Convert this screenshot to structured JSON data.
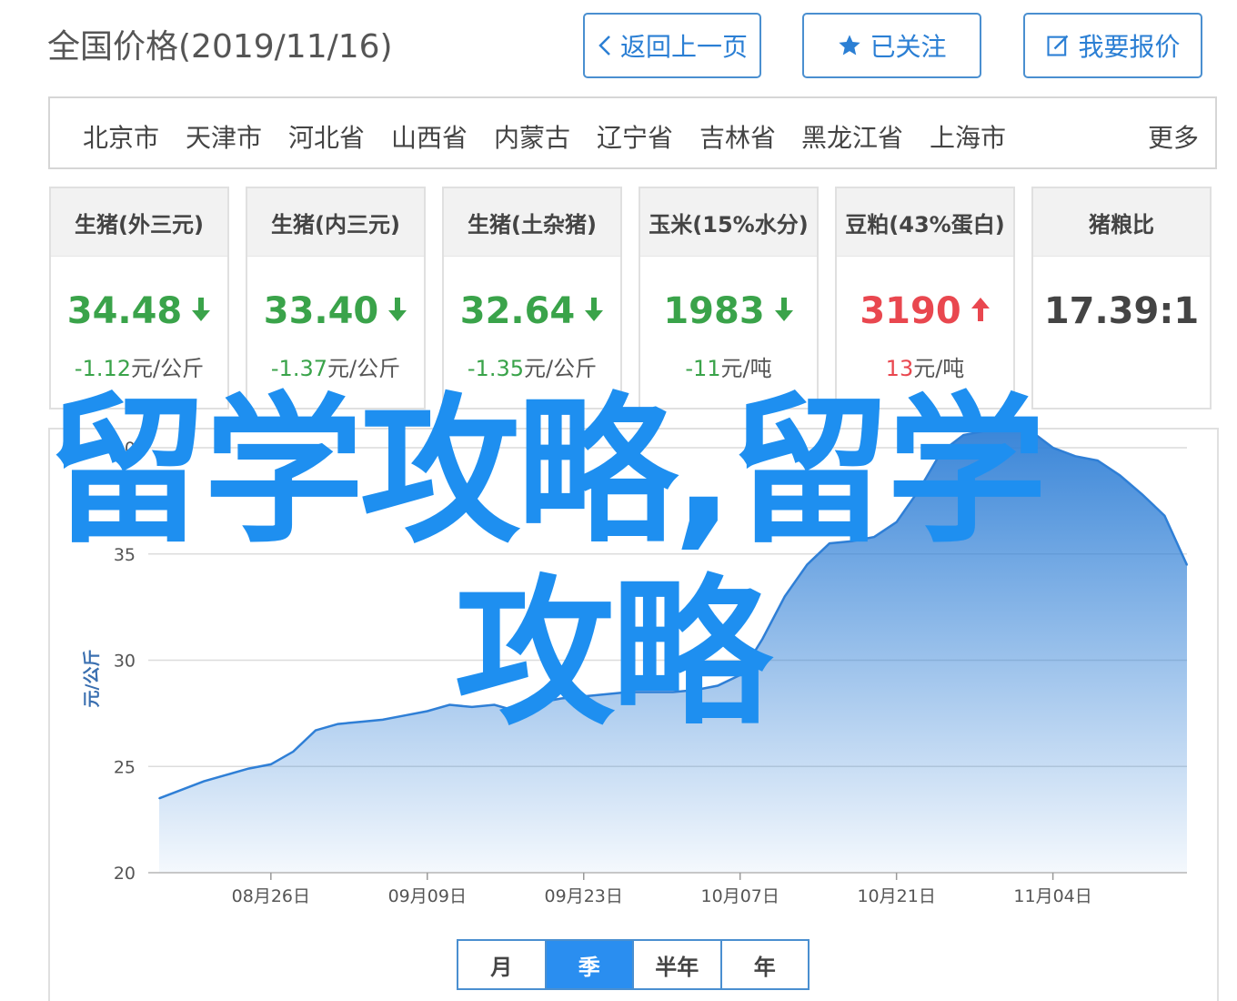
{
  "page_title": "全国价格(2019/11/16)",
  "buttons": {
    "back": "返回上一页",
    "follow": "已关注",
    "report": "我要报价"
  },
  "regions": [
    "北京市",
    "天津市",
    "河北省",
    "山西省",
    "内蒙古",
    "辽宁省",
    "吉林省",
    "黑龙江省",
    "上海市"
  ],
  "regions_more": "更多",
  "cards": [
    {
      "title": "生猪(外三元)",
      "value": "34.48",
      "trend": "down",
      "change_num": "-1.12",
      "change_unit": "元/公斤"
    },
    {
      "title": "生猪(内三元)",
      "value": "33.40",
      "trend": "down",
      "change_num": "-1.37",
      "change_unit": "元/公斤"
    },
    {
      "title": "生猪(土杂猪)",
      "value": "32.64",
      "trend": "down",
      "change_num": "-1.35",
      "change_unit": "元/公斤"
    },
    {
      "title": "玉米(15%水分)",
      "value": "1983",
      "trend": "down",
      "change_num": "-11",
      "change_unit": "元/吨"
    },
    {
      "title": "豆粕(43%蛋白)",
      "value": "3190",
      "trend": "up",
      "change_num": "13",
      "change_unit": "元/吨"
    },
    {
      "title": "猪粮比",
      "value": "17.39:1",
      "trend": "none",
      "change_num": "",
      "change_unit": ""
    }
  ],
  "colors": {
    "accent": "#2a8ef0",
    "down": "#3aa34a",
    "up": "#e9474f",
    "overlay_text": "#1e8ff0",
    "series_line": "#2f7fd6"
  },
  "overlay": {
    "line1": "留学攻略,留学",
    "line2": "攻略"
  },
  "range_tabs": [
    {
      "label": "月",
      "active": false
    },
    {
      "label": "季",
      "active": true
    },
    {
      "label": "半年",
      "active": false
    },
    {
      "label": "年",
      "active": false
    }
  ],
  "chart_data": {
    "type": "area",
    "ylabel": "元/公斤",
    "ylim": [
      20,
      40
    ],
    "yticks": [
      20,
      25,
      30,
      35,
      40
    ],
    "xticks": [
      "08月26日",
      "09月09日",
      "09月23日",
      "10月07日",
      "10月21日",
      "11月04日"
    ],
    "xrange": [
      "2019-08-16",
      "2019-11-16"
    ],
    "grid": true,
    "x": [
      "2019-08-16",
      "2019-08-18",
      "2019-08-20",
      "2019-08-22",
      "2019-08-24",
      "2019-08-26",
      "2019-08-28",
      "2019-08-30",
      "2019-09-01",
      "2019-09-03",
      "2019-09-05",
      "2019-09-07",
      "2019-09-09",
      "2019-09-11",
      "2019-09-13",
      "2019-09-15",
      "2019-09-17",
      "2019-09-19",
      "2019-09-21",
      "2019-09-23",
      "2019-09-25",
      "2019-09-27",
      "2019-09-29",
      "2019-10-01",
      "2019-10-03",
      "2019-10-05",
      "2019-10-07",
      "2019-10-09",
      "2019-10-11",
      "2019-10-13",
      "2019-10-15",
      "2019-10-17",
      "2019-10-19",
      "2019-10-21",
      "2019-10-23",
      "2019-10-25",
      "2019-10-27",
      "2019-10-29",
      "2019-10-31",
      "2019-11-02",
      "2019-11-04",
      "2019-11-06",
      "2019-11-08",
      "2019-11-10",
      "2019-11-12",
      "2019-11-14",
      "2019-11-16"
    ],
    "values": [
      23.5,
      23.9,
      24.3,
      24.6,
      24.9,
      25.1,
      25.7,
      26.7,
      27.0,
      27.1,
      27.2,
      27.4,
      27.6,
      27.9,
      27.8,
      27.9,
      27.6,
      28.0,
      28.2,
      28.3,
      28.4,
      28.5,
      28.5,
      28.5,
      28.6,
      28.8,
      29.3,
      31.0,
      33.0,
      34.5,
      35.5,
      35.6,
      35.8,
      36.5,
      38.0,
      39.8,
      40.6,
      40.8,
      41.0,
      40.8,
      40.0,
      39.6,
      39.4,
      38.7,
      37.8,
      36.8,
      34.48
    ]
  }
}
